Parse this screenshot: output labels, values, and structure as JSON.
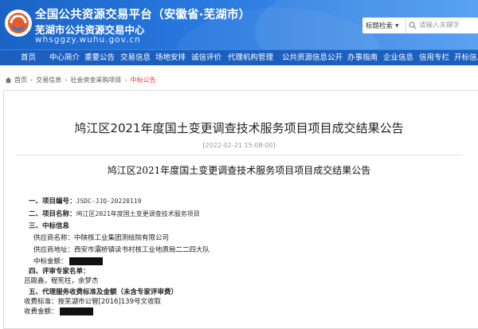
{
  "header": {
    "title": "全国公共资源交易平台（安徽省·芜湖市）",
    "subtitle": "芜湖市公共资源交易中心",
    "url": "whsggzy.wuhu.gov.cn",
    "search": {
      "select_label": "标题检索",
      "placeholder": "请输入关键字"
    }
  },
  "nav": {
    "items": [
      "首页",
      "中心简介",
      "重要公告",
      "交易信息",
      "场地安排",
      "诚信评价",
      "代理机构管理",
      "公共资源信息公开",
      "办事指南",
      "企业信息",
      "信用专栏",
      "开标信息"
    ]
  },
  "breadcrumb": {
    "items": [
      "首页",
      "交易信息",
      "社会资金采购项目"
    ],
    "current": "中标公告"
  },
  "article": {
    "title": "鸠江区2021年度国土变更调查技术服务项目项目成交结果公告",
    "date": "[2022-02-21 15:08:00]",
    "sub_title": "鸠江区2021年度国土变更调查技术服务项目项目成交结果公告",
    "lines": {
      "l1_label": "一、项目编号：",
      "l1_value": "JSDC-JJQ-20220119",
      "l2_label": "二、项目名称：",
      "l2_value": "鸠江区2021年度国土变更调查技术服务项目",
      "l3_label": "三、中标信息",
      "supplier_name": "供应商名称：中陕核工业集团测绘院有限公司",
      "supplier_addr": "供应商地址：西安市灞桥镇读书村核工业地质局二二四大队",
      "amount_label": "中标金额：",
      "l4_label": "四、评审专家名单：",
      "experts": "吕殿鑫，程宪柱，余梦杰",
      "l5_label": "五、代理服务收费标准及金额（未含专家评审费）",
      "fee_standard": "收费标准：按芜湖市公管[2016]139号文收取",
      "fee_amount_label": "收费金额："
    }
  },
  "colors": {
    "header_blue": "#1a63c5",
    "nav_blue": "#1b5fbf",
    "accent_red": "#e4393c"
  }
}
